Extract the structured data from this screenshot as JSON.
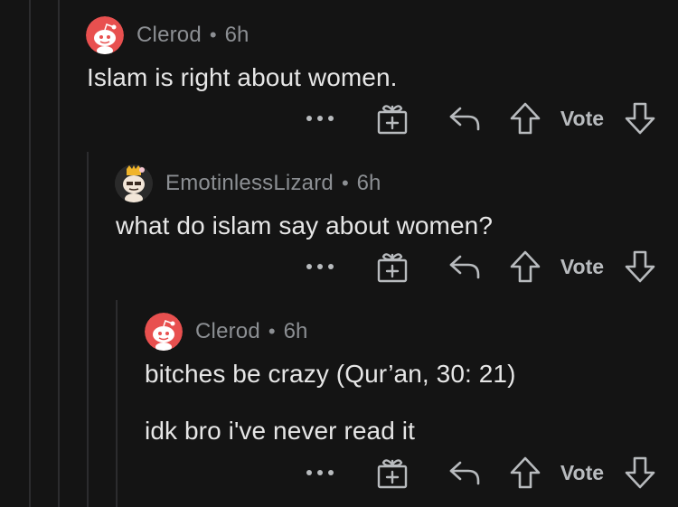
{
  "comments": [
    {
      "author": "Clerod",
      "separator": "•",
      "age": "6h",
      "lines": [
        "Islam is right about women."
      ],
      "avatar_icon": "reddit-snoo-avatar-icon",
      "vote_label": "Vote"
    },
    {
      "author": "EmotinlessLizard",
      "separator": "•",
      "age": "6h",
      "lines": [
        "what do islam say about women?"
      ],
      "avatar_icon": "custom-snoo-avatar-icon",
      "vote_label": "Vote"
    },
    {
      "author": "Clerod",
      "separator": "•",
      "age": "6h",
      "lines": [
        "bitches be crazy (Qur’an, 30: 21)",
        "idk bro i've never read it"
      ],
      "avatar_icon": "reddit-snoo-avatar-icon",
      "vote_label": "Vote"
    }
  ],
  "icons": {
    "more": "more-options-icon",
    "award": "award-gift-icon",
    "reply": "reply-arrow-icon",
    "upvote": "upvote-arrow-icon",
    "downvote": "downvote-arrow-icon"
  },
  "colors": {
    "background": "#141414",
    "thread_line": "#2c2c2e",
    "meta_text": "#8c8f93",
    "body_text": "#e6e6e6",
    "snoo_red": "#e8504f"
  }
}
